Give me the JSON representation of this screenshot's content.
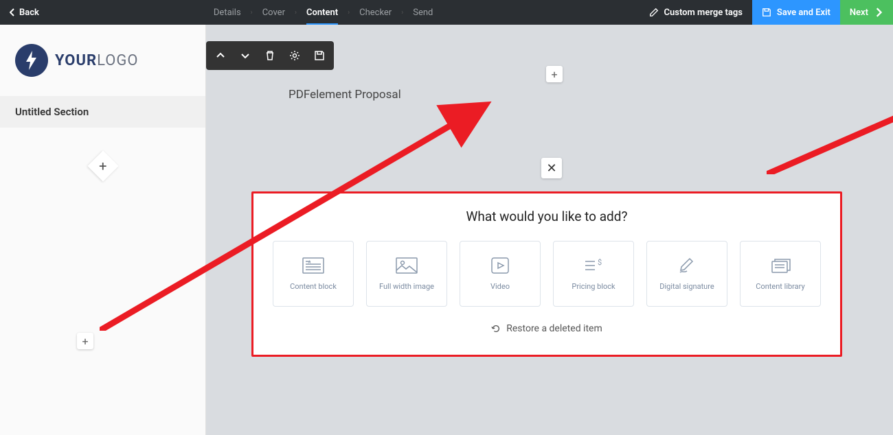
{
  "topbar": {
    "back": "Back",
    "breadcrumbs": [
      "Details",
      "Cover",
      "Content",
      "Checker",
      "Send"
    ],
    "active_index": 2,
    "custom_merge": "Custom merge tags",
    "save": "Save and Exit",
    "next": "Next"
  },
  "sidebar": {
    "logo_your": "YOUR",
    "logo_logo": "LOGO",
    "section": "Untitled Section"
  },
  "document": {
    "title": "PDFelement Proposal"
  },
  "panel": {
    "heading": "What would you like to add?",
    "cards": [
      {
        "label": "Content block"
      },
      {
        "label": "Full width image"
      },
      {
        "label": "Video"
      },
      {
        "label": "Pricing block"
      },
      {
        "label": "Digital signature"
      },
      {
        "label": "Content library"
      }
    ],
    "restore": "Restore a deleted item"
  }
}
